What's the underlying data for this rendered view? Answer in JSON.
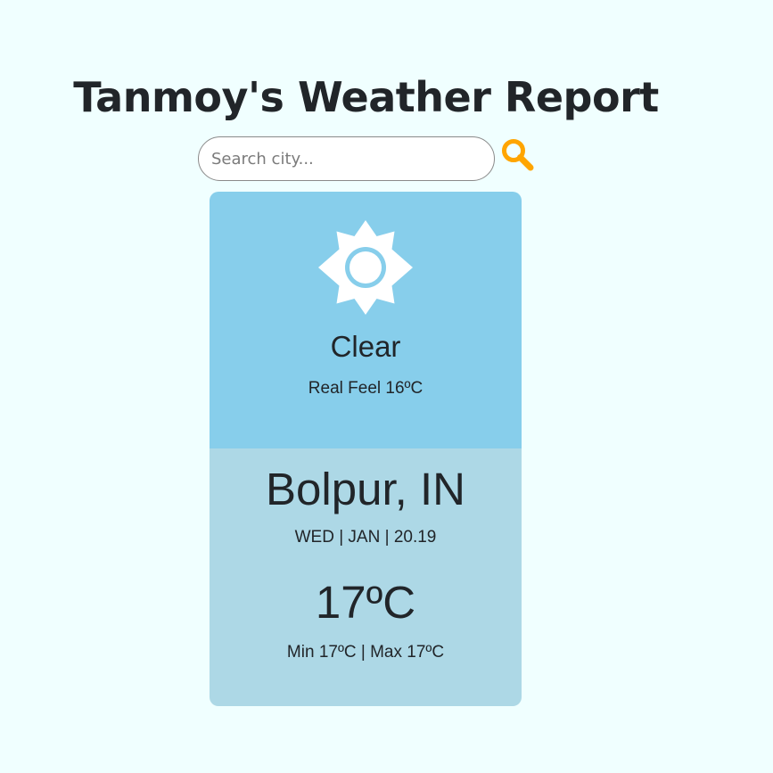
{
  "header": {
    "title": "Tanmoy's Weather Report"
  },
  "search": {
    "placeholder": "Search city...",
    "value": "",
    "button_icon": "search-icon",
    "button_color": "#ffa500"
  },
  "weather": {
    "icon": "sun-icon",
    "condition": "Clear",
    "real_feel": "Real Feel 16ºC",
    "city": "Bolpur, IN",
    "date": "WED | JAN | 20.19",
    "temperature": "17ºC",
    "min_max": "Min 17ºC | Max 17ºC"
  },
  "colors": {
    "background": "#f0ffff",
    "card_top": "#87ceeb",
    "card_bottom": "#add8e6",
    "text": "#212529"
  }
}
